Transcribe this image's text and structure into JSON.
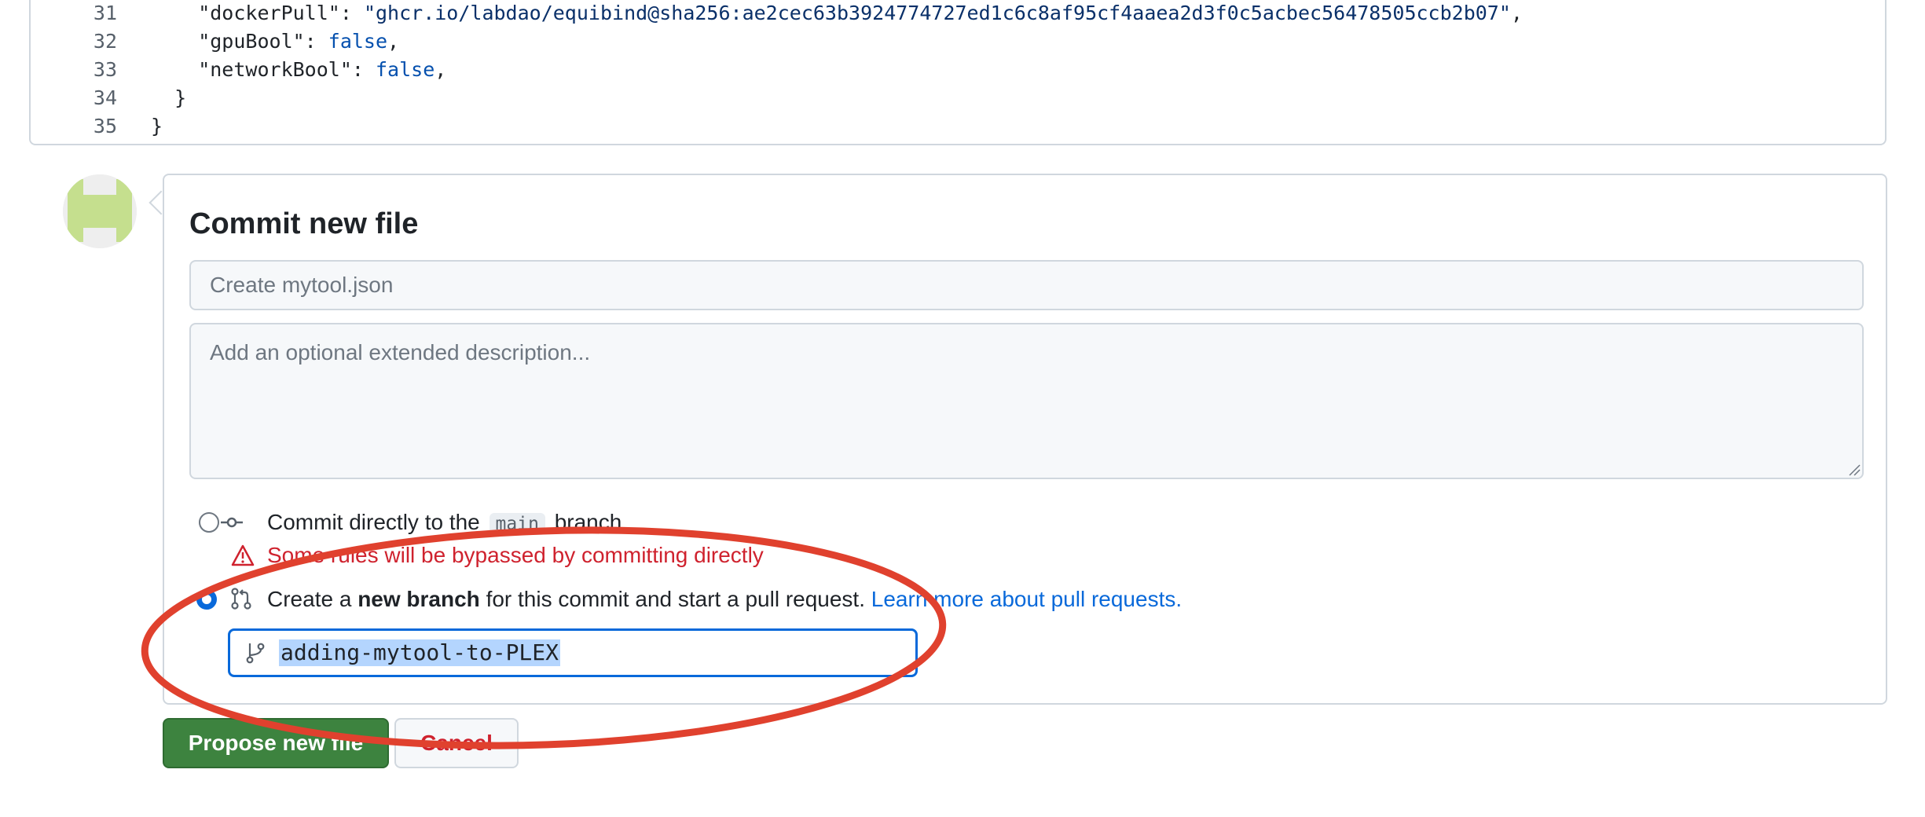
{
  "code": {
    "lines": [
      {
        "num": "31",
        "parts": [
          {
            "t": "    \"dockerPull\": ",
            "c": "plain"
          },
          {
            "t": "\"ghcr.io/labdao/equibind@sha256:ae2cec63b3924774727ed1c6c8af95cf4aaea2d3f0c5acbec56478505ccb2b07\"",
            "c": "str"
          },
          {
            "t": ",",
            "c": "plain"
          }
        ]
      },
      {
        "num": "32",
        "parts": [
          {
            "t": "    \"gpuBool\": ",
            "c": "plain"
          },
          {
            "t": "false",
            "c": "kw"
          },
          {
            "t": ",",
            "c": "plain"
          }
        ]
      },
      {
        "num": "33",
        "parts": [
          {
            "t": "    \"networkBool\": ",
            "c": "plain"
          },
          {
            "t": "false",
            "c": "kw"
          },
          {
            "t": ",",
            "c": "plain"
          }
        ]
      },
      {
        "num": "34",
        "parts": [
          {
            "t": "  }",
            "c": "plain"
          }
        ]
      },
      {
        "num": "35",
        "parts": [
          {
            "t": "}",
            "c": "plain"
          }
        ]
      }
    ]
  },
  "commit": {
    "title": "Commit new file",
    "summary_placeholder": "Create mytool.json",
    "summary_value": "",
    "description_placeholder": "Add an optional extended description...",
    "option_direct": {
      "text_before": "Commit directly to the",
      "branch": "main",
      "text_after": "branch.",
      "checked": false
    },
    "warning": "Some rules will be bypassed by committing directly",
    "option_new_branch": {
      "text_before": "Create a",
      "bold": "new branch",
      "text_after": "for this commit and start a pull request.",
      "link": "Learn more about pull requests.",
      "checked": true
    },
    "branch_name": "adding-mytool-to-PLEX"
  },
  "buttons": {
    "propose": "Propose new file",
    "cancel": "Cancel"
  },
  "colors": {
    "primary_button": "#3d833f",
    "link": "#0969da",
    "danger": "#cf222e",
    "annotation": "#e0412e",
    "avatar": "#c5df8e"
  },
  "icons": {
    "commit": "git-commit-icon",
    "pull_request": "git-pull-request-icon",
    "branch": "git-branch-icon",
    "warning": "alert-triangle-icon"
  }
}
